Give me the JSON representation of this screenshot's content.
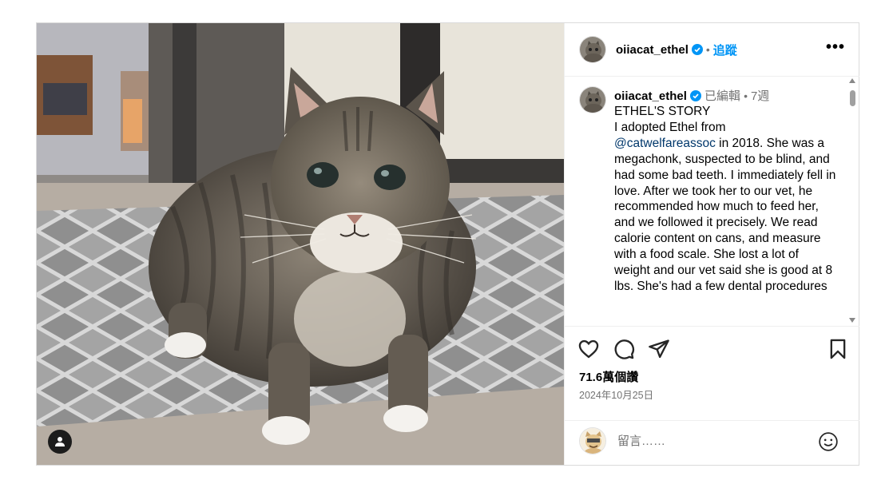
{
  "post": {
    "author": "oiiacat_ethel",
    "follow_label": "追蹤",
    "dot": "•",
    "more_label": "•••"
  },
  "caption": {
    "author": "oiiacat_ethel",
    "edited_label": "已編輯",
    "dot": "•",
    "age": "7週",
    "title": "ETHEL'S STORY",
    "body_before_mention": "\nI adopted Ethel from\n",
    "mention": "@catwelfareassoc",
    "body_after_mention": " in 2018. She was a megachonk, suspected to be blind, and had some bad teeth. I immediately fell in love. After we took her to our vet, he recommended how much to feed her, and we followed it precisely. We read calorie content on cans, and measure with a food scale. She lost a lot of weight and our vet said she is good at 8 lbs. She's had a few dental procedures"
  },
  "actions": {
    "likes": "71.6萬個讚",
    "date": "2024年10月25日"
  },
  "comment": {
    "placeholder": "留言……"
  },
  "icons": {
    "like": "heart-icon",
    "comment": "comment-bubble-icon",
    "share": "paper-plane-icon",
    "save": "bookmark-icon",
    "emoji": "smiley-icon",
    "tag": "person-icon",
    "verified": "verified-badge-icon"
  },
  "colors": {
    "link_blue": "#0095f6",
    "mention_blue": "#00376b",
    "verified_blue": "#0095f6",
    "muted_text": "#737373",
    "border": "#dbdbdb"
  }
}
